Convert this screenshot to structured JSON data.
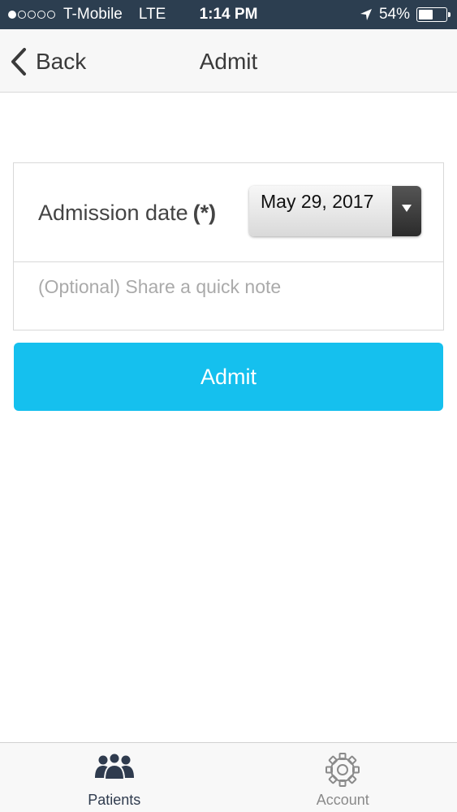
{
  "status_bar": {
    "carrier": "T-Mobile",
    "network": "LTE",
    "time": "1:14 PM",
    "battery": "54%",
    "battery_level": 0.54
  },
  "nav": {
    "back_label": "Back",
    "title": "Admit"
  },
  "form": {
    "date_label": "Admission date",
    "date_required": "(*)",
    "date_value": "May 29, 2017",
    "note_placeholder": "(Optional) Share a quick note"
  },
  "admit_button": "Admit",
  "tabs": [
    {
      "label": "Patients",
      "icon": "patients-icon"
    },
    {
      "label": "Account",
      "icon": "gear-icon"
    }
  ],
  "colors": {
    "status_bar": "#2c3e50",
    "accent": "#15c0ee",
    "tab_active": "#2f3b4e",
    "tab_inactive": "#8a8a8a"
  }
}
